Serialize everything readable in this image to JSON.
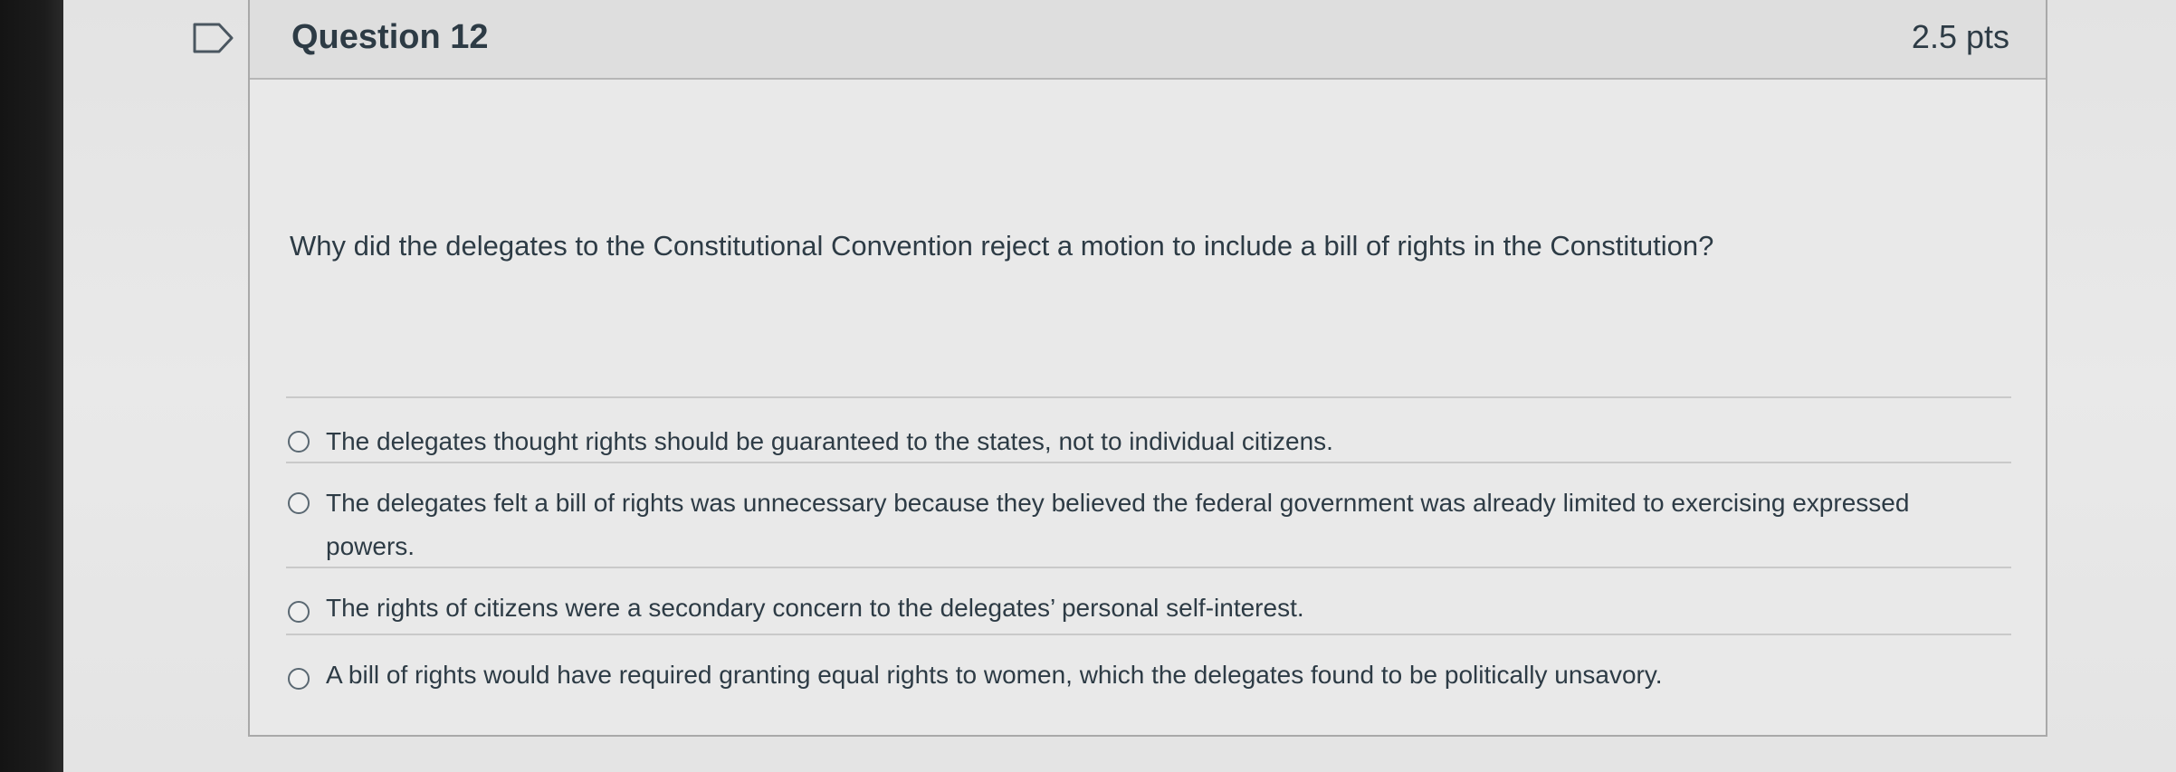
{
  "question": {
    "title": "Question 12",
    "points": "2.5 pts",
    "text": "Why did the delegates to the Constitutional Convention reject a motion to include a bill of rights in the Constitution?"
  },
  "answers": [
    {
      "label": "The delegates thought rights should be guaranteed to the states, not to individual citizens."
    },
    {
      "label": "The delegates felt a bill of rights was unnecessary because they believed the federal government was already limited to exercising expressed powers."
    },
    {
      "label": "The rights of citizens were a secondary concern to the delegates’ personal self-interest."
    },
    {
      "label": "A bill of rights would have required granting equal rights to women, which the delegates found to be politically unsavory."
    }
  ],
  "icons": {
    "flag": "flag-icon",
    "radio": "radio-unselected"
  },
  "colors": {
    "text": "#2d3b45",
    "border": "#a9a9a9",
    "header_bg": "#dedede"
  }
}
